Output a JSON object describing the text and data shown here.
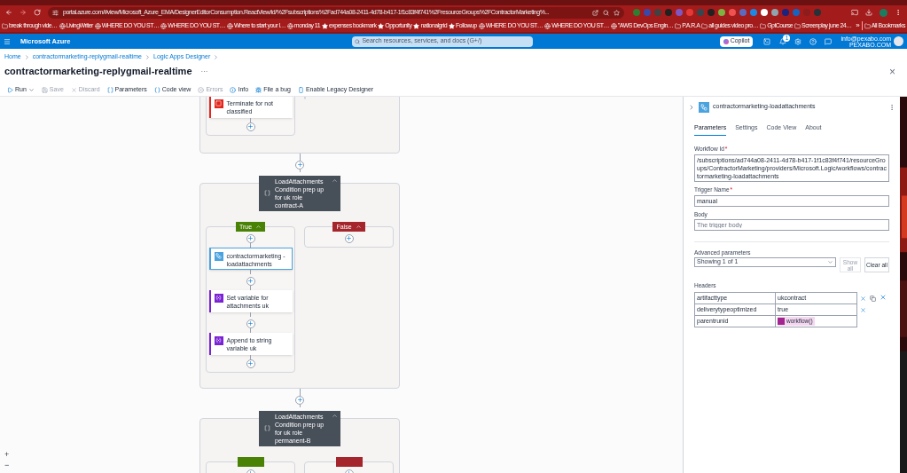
{
  "browser": {
    "url": "portal.azure.com/#view/Microsoft_Azure_EMA/DesignerEditorConsumption.ReactView/id/%2Fsubscriptions%2Fad744a08-2411-4d78-b417-1f1c83f4f741%2FresourceGroups%2FContractorMarketing%...",
    "bookmarks": [
      {
        "label": "break through vide…",
        "kind": "folder"
      },
      {
        "label": "LivingWriter",
        "kind": "site"
      },
      {
        "label": "WHERE DO YOU ST…",
        "kind": "site"
      },
      {
        "label": "WHERE DO YOU ST…",
        "kind": "site"
      },
      {
        "label": "Where to start your l…",
        "kind": "site"
      },
      {
        "label": "monday 11",
        "kind": "site"
      },
      {
        "label": "expenses bookmark",
        "kind": "star"
      },
      {
        "label": "Opportunity",
        "kind": "star"
      },
      {
        "label": "nationalgrid",
        "kind": "star"
      },
      {
        "label": "Followup",
        "kind": "star"
      },
      {
        "label": "WHERE DO YOU ST…",
        "kind": "site"
      },
      {
        "label": "WHERE DO YOU ST…",
        "kind": "site"
      },
      {
        "label": "\"AWS DevOps Engin…",
        "kind": "site"
      },
      {
        "label": "P.A.R.A",
        "kind": "folder"
      },
      {
        "label": "all guides video pro…",
        "kind": "folder"
      },
      {
        "label": "GptCourse",
        "kind": "folder"
      },
      {
        "label": "Screenplay june 24…",
        "kind": "folder"
      }
    ],
    "more_bookmarks": "»",
    "all_bookmarks": "All Bookmarks"
  },
  "portal": {
    "brand": "Microsoft Azure",
    "search": {
      "placeholder": "Search resources, services, and docs (G+/)"
    },
    "copilot": "Copilot",
    "notifications": "1",
    "account": "info@pexabo.com",
    "tenant": "PEXABO.COM"
  },
  "breadcrumb": [
    "Home",
    "contractormarketing-replygmail-realtime",
    "Logic Apps Designer"
  ],
  "page_title": "contractormarketing-replygmail-realtime",
  "more": "···",
  "close": "×",
  "toolbar": [
    {
      "label": "Run",
      "disabled": false
    },
    {
      "label": "Save",
      "disabled": true
    },
    {
      "label": "Discard",
      "disabled": true
    },
    {
      "label": "Parameters",
      "disabled": false
    },
    {
      "label": "Code view",
      "disabled": false
    },
    {
      "label": "Errors",
      "disabled": true
    },
    {
      "label": "Info",
      "disabled": false
    },
    {
      "label": "File a bug",
      "disabled": false
    },
    {
      "label": "Enable Legacy Designer",
      "disabled": false
    }
  ],
  "canvas": {
    "flow": [
      {
        "kind": "scope",
        "branches": [
          {
            "kind": "plain",
            "steps": [
              {
                "title": "Terminate for not classified",
                "kind": "terminate",
                "selected": false
              }
            ]
          },
          {
            "kind": "plain"
          }
        ]
      },
      {
        "kind": "condition",
        "title": "LoadAttachments Condition prep up for uk role contract-A",
        "branches": [
          {
            "kind": "true",
            "label": "True",
            "expanded": true,
            "steps": [
              {
                "title": "contractormarketing -loadattachments",
                "kind": "workflow",
                "selected": true
              },
              {
                "title": "Set variable for attachments uk",
                "kind": "variable",
                "selected": false
              },
              {
                "title": "Append to string variable uk",
                "kind": "variable",
                "selected": false
              }
            ]
          },
          {
            "kind": "false",
            "label": "False",
            "expanded": true
          }
        ]
      },
      {
        "kind": "condition",
        "title": "LoadAttachments Condition prep up for uk role permanent-B",
        "branches": [
          {
            "kind": "true"
          },
          {
            "kind": "false"
          }
        ]
      }
    ],
    "zoom_in": "+",
    "zoom_out": "−"
  },
  "panel": {
    "title": "contractormarketing-loadattachments",
    "tabs": [
      {
        "label": "Parameters",
        "selected": true
      },
      {
        "label": "Settings",
        "selected": false
      },
      {
        "label": "Code View",
        "selected": false
      },
      {
        "label": "About",
        "selected": false
      }
    ],
    "fields": [
      {
        "label": "Workflow Id",
        "mark": "*",
        "value": "/subscriptions/ad744a08-2411-4d78-b417-1f1c83f4f741/resourceGroups/ContractorMarketing/providers/Microsoft.Logic/workflows/contractormarketing-loadattachments"
      },
      {
        "label": "Trigger Name",
        "mark": "*",
        "value": "manual"
      },
      {
        "label": "Body",
        "placeholder": "The trigger body"
      }
    ],
    "advanced": {
      "label": "Advanced parameters",
      "value": "Showing 1 of 1",
      "show_all": "Show all",
      "clear_all": "Clear all"
    },
    "headers": {
      "label": "Headers",
      "rows": [
        {
          "key": "artifacttype",
          "value": "ukcontract"
        },
        {
          "key": "deliverytypeoptimized",
          "value": "true"
        },
        {
          "key": "parentrunid",
          "token": "workflow()"
        }
      ]
    }
  }
}
